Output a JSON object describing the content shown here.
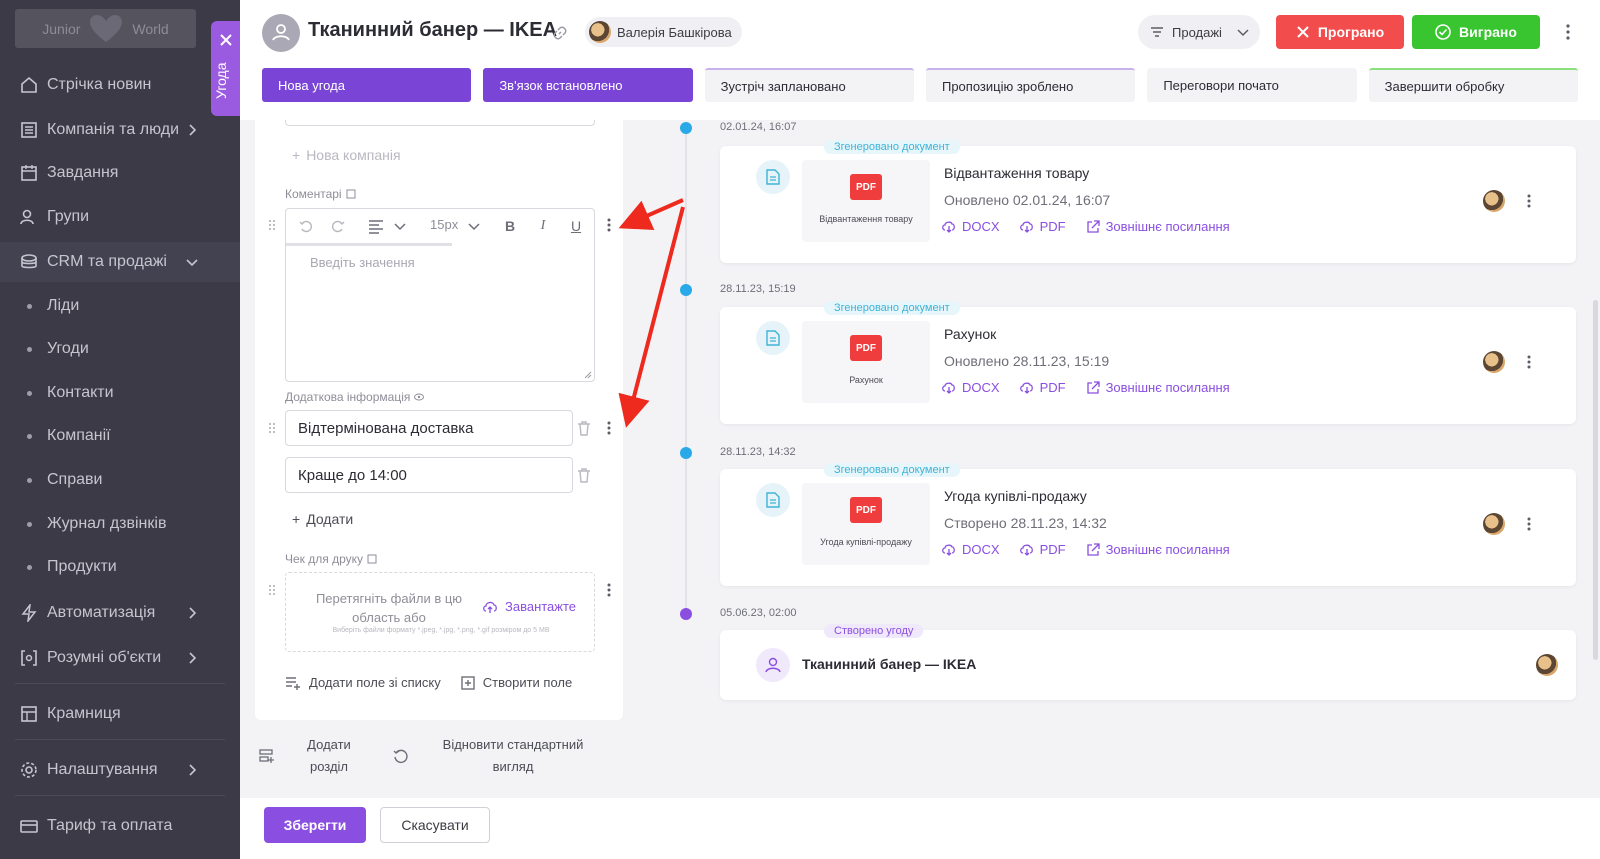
{
  "sidebar": {
    "logo_text_left": "Junior",
    "logo_text_right": "World",
    "items": [
      {
        "label": "Стрічка новин",
        "icon": "home-icon"
      },
      {
        "label": "Компанія та люди",
        "icon": "building-icon"
      },
      {
        "label": "Завдання",
        "icon": "calendar-icon"
      },
      {
        "label": "Групи",
        "icon": "users-icon"
      },
      {
        "label": "CRM та продажі",
        "icon": "coins-icon"
      },
      {
        "label": "Автоматизація",
        "icon": "lightning-icon"
      },
      {
        "label": "Розумні об'єкти",
        "icon": "smart-objects-icon"
      },
      {
        "label": "Крамниця",
        "icon": "store-icon"
      },
      {
        "label": "Налаштування",
        "icon": "gear-icon"
      },
      {
        "label": "Тариф та оплата",
        "icon": "card-icon"
      }
    ],
    "crm_sub": [
      "Ліди",
      "Угоди",
      "Контакти",
      "Компанії",
      "Справи",
      "Журнал дзвінків",
      "Продукти"
    ]
  },
  "deal_tab": {
    "label": "Угода"
  },
  "header": {
    "title": "Тканинний банер — IKEA",
    "owner": "Валерія Башкірова",
    "pipeline": "Продажі",
    "lost_label": "Програно",
    "won_label": "Виграно"
  },
  "stages": [
    "Нова угода",
    "Зв'язок встановлено",
    "Зустріч заплановано",
    "Пропозицію зроблено",
    "Переговори почато",
    "Завершити обробку"
  ],
  "form": {
    "new_company": "Нова компанія",
    "comments_label": "Коментарі",
    "font_size": "15px",
    "editor_placeholder": "Введіть значення",
    "extra_label": "Додаткова інформація",
    "extra_values": [
      "Відтермінована доставка",
      "Краще до 14:00"
    ],
    "add_label": "Додати",
    "receipt_label": "Чек для друку",
    "dropzone_text": "Перетягніть файли в цю область або",
    "dropzone_upload": "Завантажте",
    "dropzone_hint": "Виберіть файли формату *.jpeg, *.jpg, *.png, *.gif розміром до 5 MB",
    "add_from_list": "Додати поле зі списку",
    "create_field": "Створити поле",
    "add_section": "Додати розділ",
    "restore_view": "Відновити стандартний вигляд"
  },
  "timeline": [
    {
      "date": "02.01.24, 16:07",
      "tag": "Згенеровано документ",
      "title": "Відвантаження товару",
      "sub": "Оновлено 02.01.24, 16:07",
      "thumb_caption": "Відвантаження товару"
    },
    {
      "date": "28.11.23, 15:19",
      "tag": "Згенеровано документ",
      "title": "Рахунок",
      "sub": "Оновлено 28.11.23, 15:19",
      "thumb_caption": "Рахунок"
    },
    {
      "date": "28.11.23, 14:32",
      "tag": "Згенеровано документ",
      "title": "Угода купівлі-продажу",
      "sub": "Створено 28.11.23, 14:32",
      "thumb_caption": "Угода купівлі-продажу"
    },
    {
      "date": "05.06.23, 02:00",
      "tag": "Створено угоду",
      "title": "Тканинний банер — IKEA"
    }
  ],
  "doc_links": {
    "docx": "DOCX",
    "pdf": "PDF",
    "external": "Зовнішнє посилання",
    "badge": "PDF"
  },
  "footer": {
    "save": "Зберегти",
    "cancel": "Скасувати"
  },
  "colors": {
    "accent": "#8a4fe0",
    "stage_done": "#7a45d6",
    "lost": "#f24c4c",
    "won": "#39c52f",
    "timeline_blue": "#2aa9e8",
    "annotation_arrow": "#ee2a1e"
  }
}
